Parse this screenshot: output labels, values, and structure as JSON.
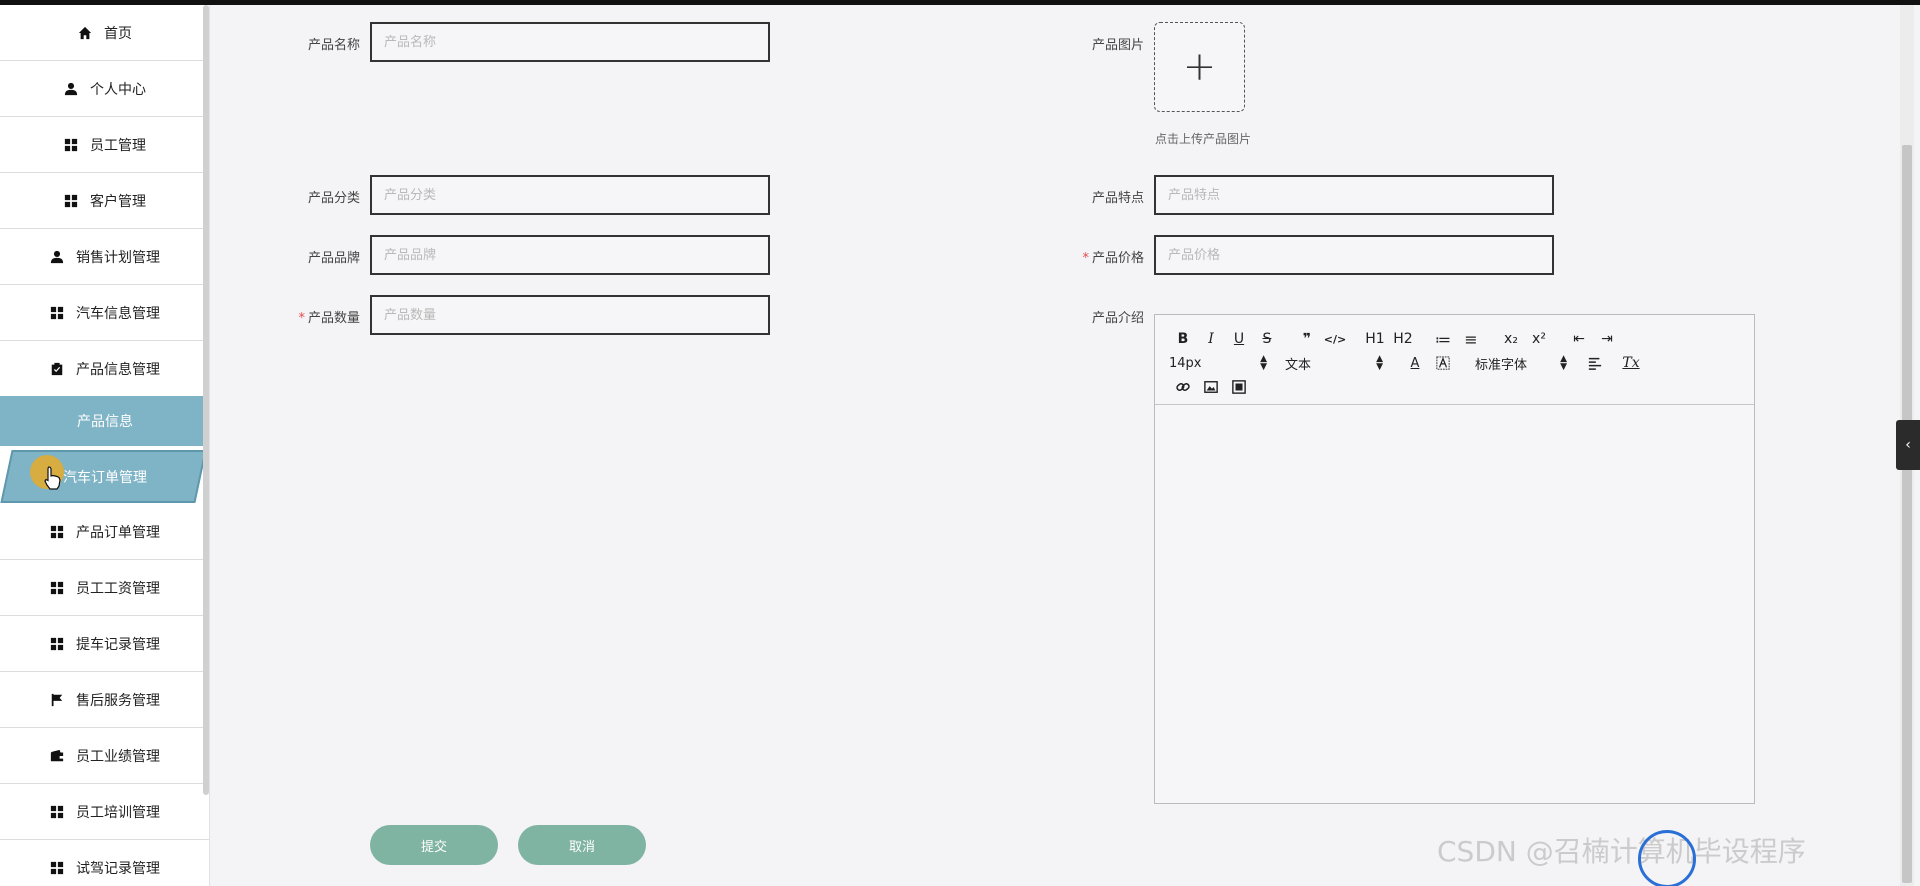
{
  "sidebar": {
    "items": [
      {
        "label": "首页",
        "icon": "home-icon"
      },
      {
        "label": "个人中心",
        "icon": "user-icon"
      },
      {
        "label": "员工管理",
        "icon": "grid-icon"
      },
      {
        "label": "客户管理",
        "icon": "grid-icon"
      },
      {
        "label": "销售计划管理",
        "icon": "user-icon"
      },
      {
        "label": "汽车信息管理",
        "icon": "grid-icon"
      },
      {
        "label": "产品信息管理",
        "icon": "clipboard-icon"
      }
    ],
    "submenu": {
      "label": "产品信息"
    },
    "active": {
      "label": "汽车订单管理",
      "icon": "grid-icon"
    },
    "items_after": [
      {
        "label": "产品订单管理",
        "icon": "grid-icon"
      },
      {
        "label": "员工工资管理",
        "icon": "grid-icon"
      },
      {
        "label": "提车记录管理",
        "icon": "grid-icon"
      },
      {
        "label": "售后服务管理",
        "icon": "flag-icon"
      },
      {
        "label": "员工业绩管理",
        "icon": "wallet-icon"
      },
      {
        "label": "员工培训管理",
        "icon": "grid-icon"
      },
      {
        "label": "试驾记录管理",
        "icon": "grid-icon"
      }
    ]
  },
  "form": {
    "name": {
      "label": "产品名称",
      "placeholder": "产品名称",
      "required": false
    },
    "image": {
      "label": "产品图片",
      "upload_plus": "+",
      "hint": "点击上传产品图片"
    },
    "category": {
      "label": "产品分类",
      "placeholder": "产品分类",
      "required": false
    },
    "feature": {
      "label": "产品特点",
      "placeholder": "产品特点",
      "required": false
    },
    "brand": {
      "label": "产品品牌",
      "placeholder": "产品品牌",
      "required": false
    },
    "price": {
      "label": "产品价格",
      "placeholder": "产品价格",
      "required": true
    },
    "quantity": {
      "label": "产品数量",
      "placeholder": "产品数量",
      "required": true
    },
    "intro": {
      "label": "产品介绍"
    },
    "required_mark": "*"
  },
  "editor": {
    "row1": [
      "B",
      "I",
      "U",
      "S",
      "❞",
      "</>",
      "H1",
      "H2",
      "≔",
      "≡",
      "x₂",
      "x²",
      "⇤",
      "⇥"
    ],
    "font_size": "14px",
    "text_type": "文本",
    "font_family": "标准字体",
    "color_btn": "A",
    "clear_btn": "Tx"
  },
  "buttons": {
    "submit": "提交",
    "cancel": "取消"
  },
  "misc": {
    "collapse_arrow": "‹",
    "watermark": "CSDN @召楠计算机毕设程序"
  },
  "colors": {
    "accent": "#7fb3c6",
    "button": "#7fb3a2",
    "required": "#e34b4b"
  }
}
